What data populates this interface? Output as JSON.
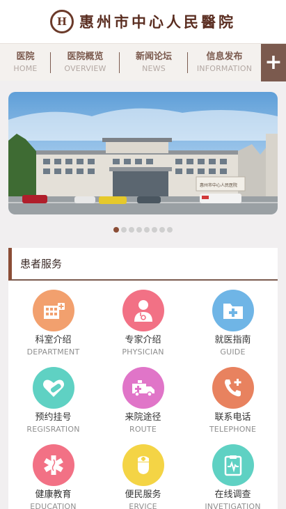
{
  "header": {
    "logo_mark": "H",
    "hospital_name": "惠州市中心人民醫院"
  },
  "nav": {
    "items": [
      {
        "zh": "医院",
        "en": "HOME"
      },
      {
        "zh": "医院概览",
        "en": "OVERVIEW"
      },
      {
        "zh": "新闻论坛",
        "en": "NEWS"
      },
      {
        "zh": "信息发布",
        "en": "INFORMATION"
      }
    ],
    "more_label": "+"
  },
  "banner": {
    "sign_text": "惠州市中心人民医院",
    "slide_count": 8,
    "active_slide": 1
  },
  "patient_services": {
    "title": "患者服务",
    "items": [
      {
        "zh": "科室介绍",
        "en": "DEPARTMENT",
        "icon": "department-icon",
        "color": "#f2a06e"
      },
      {
        "zh": "专家介绍",
        "en": "PHYSICIAN",
        "icon": "doctor-icon",
        "color": "#f27185"
      },
      {
        "zh": "就医指南",
        "en": "GUIDE",
        "icon": "folder-plus-icon",
        "color": "#6fb5e6"
      },
      {
        "zh": "预约挂号",
        "en": "REGISRATION",
        "icon": "heart-bandage-icon",
        "color": "#5fd1c3"
      },
      {
        "zh": "来院途径",
        "en": "ROUTE",
        "icon": "ambulance-icon",
        "color": "#e075c8"
      },
      {
        "zh": "联系电话",
        "en": "TELEPHONE",
        "icon": "phone-plus-icon",
        "color": "#e8825f"
      },
      {
        "zh": "健康教育",
        "en": "EDUCATION",
        "icon": "medical-star-icon",
        "color": "#f27185"
      },
      {
        "zh": "便民服务",
        "en": "ERVICE",
        "icon": "nurse-icon",
        "color": "#f4d445"
      },
      {
        "zh": "在线调查",
        "en": "INVETIGATION",
        "icon": "clipboard-icon",
        "color": "#5fd1c3"
      }
    ]
  }
}
